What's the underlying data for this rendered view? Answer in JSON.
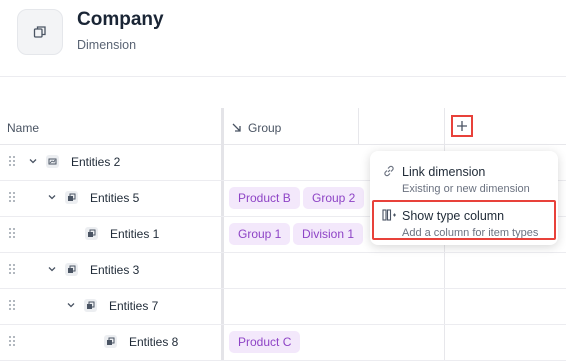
{
  "header": {
    "title": "Company",
    "subtitle": "Dimension"
  },
  "columns": {
    "name": "Name",
    "group": "Group"
  },
  "rows": [
    {
      "label": "Entities 2",
      "chips": []
    },
    {
      "label": "Entities 5",
      "chips": [
        "Product B",
        "Group 2"
      ]
    },
    {
      "label": "Entities 1",
      "chips": [
        "Group 1",
        "Division 1"
      ]
    },
    {
      "label": "Entities 3",
      "chips": []
    },
    {
      "label": "Entities 7",
      "chips": []
    },
    {
      "label": "Entities 8",
      "chips": [
        "Product C"
      ]
    }
  ],
  "menu": {
    "link": {
      "label": "Link dimension",
      "desc": "Existing or new dimension"
    },
    "show_type": {
      "label": "Show type column",
      "desc": "Add a column for item types"
    }
  },
  "colors": {
    "chip_bg": "#f3e8fb",
    "chip_text": "#8e44c6",
    "highlight": "#e8413a"
  },
  "icons": [
    "copy-icon",
    "drag-handle-icon",
    "chevron-down-icon",
    "entity-icon",
    "collapse-arrow-icon",
    "plus-icon",
    "link-icon",
    "column-icon"
  ]
}
